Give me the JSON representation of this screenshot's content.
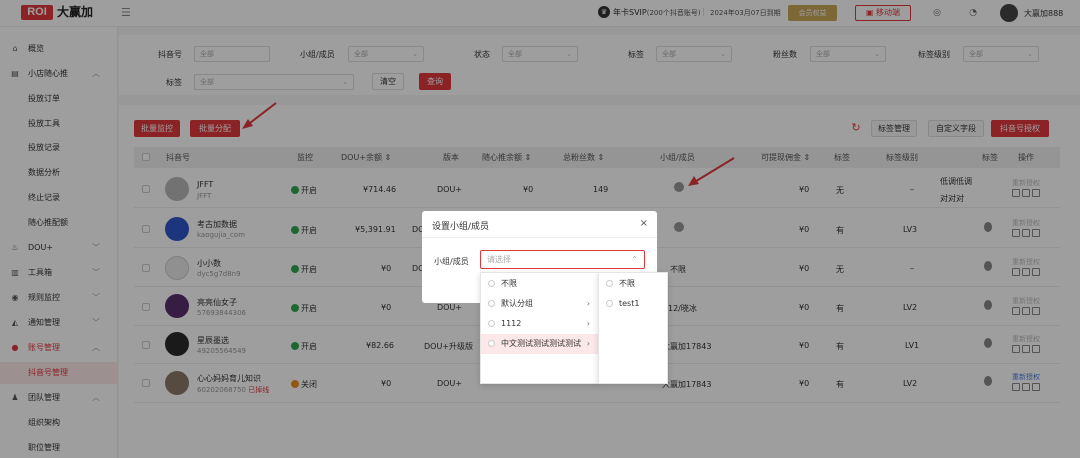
{
  "app": {
    "logo_mark": "ROI",
    "name": "大赢加",
    "menu_icon": "hamburger-icon"
  },
  "header": {
    "vip_label": "年卡SVIP",
    "vip_note": "(200个抖音账号)",
    "expire": "2024年03月07日到期",
    "member_button": "会员权益",
    "mobile_button": "移动端",
    "user_name": "大赢加888",
    "accent": "#e0393e",
    "gold": "#c9a65a"
  },
  "sidebar": {
    "items": [
      {
        "label": "概览",
        "icon": "home-icon"
      },
      {
        "label": "小店随心推",
        "icon": "store-icon",
        "chevron": "︿"
      },
      {
        "label": "投放订单"
      },
      {
        "label": "投放工具"
      },
      {
        "label": "投放记录"
      },
      {
        "label": "数据分析"
      },
      {
        "label": "终止记录"
      },
      {
        "label": "随心推配额"
      },
      {
        "label": "DOU+",
        "icon": "fire-icon",
        "chevron": "﹀"
      },
      {
        "label": "工具箱",
        "icon": "toolbox-icon",
        "chevron": "﹀"
      },
      {
        "label": "规则监控",
        "icon": "monitor-icon",
        "chevron": "﹀"
      },
      {
        "label": "通知管理",
        "icon": "bell-icon",
        "chevron": "﹀"
      },
      {
        "label": "账号管理",
        "icon": "user-icon",
        "chevron": "︿"
      },
      {
        "label": "抖音号管理"
      },
      {
        "label": "团队管理",
        "icon": "team-icon",
        "chevron": "︿"
      },
      {
        "label": "组织架构"
      },
      {
        "label": "职位管理"
      }
    ]
  },
  "filters": {
    "douyin_label": "抖音号",
    "douyin_value": "全部",
    "group_label": "小组/成员",
    "group_value": "全部",
    "status_label": "状态",
    "status_value": "全部",
    "tag_label1": "标签",
    "tag_value1": "全部",
    "fans_label": "粉丝数",
    "fans_value": "全部",
    "tag_level_label": "标签级别",
    "tag_level_value": "全部",
    "tag_label2": "标签",
    "tag_value2": "全部",
    "clear": "清空",
    "query": "查询"
  },
  "toolbar": {
    "batch_monitor": "批量监控",
    "batch_assign": "批量分配",
    "tag_manage": "标签管理",
    "custom_field": "自定义字段",
    "authorize": "抖音号授权"
  },
  "table": {
    "headers": {
      "account": "抖音号",
      "monitor": "监控",
      "dou_balance": "DOU+余额 ⇕",
      "version": "版本",
      "suixin_balance": "随心推余额 ⇕",
      "total_fans": "总粉丝数 ⇕",
      "group": "小组/成员",
      "withdraw": "可提现佣金 ⇕",
      "tag": "标签",
      "tag_level": "标签级别",
      "tag2": "标签",
      "action": "操作"
    },
    "rows": [
      {
        "name": "JFFT",
        "id": "JFFT",
        "monitor": "开启",
        "dou": "¥714.46",
        "version": "DOU+",
        "suixin": "¥0",
        "fans": "149",
        "group": "",
        "withdraw": "¥0",
        "tag": "无",
        "level": "–",
        "tag2a": "低调低调",
        "tag2b": "对对对",
        "action": "重新授权",
        "avatar_color": "#b8b8b8"
      },
      {
        "name": "考古加数据",
        "id": "kaogujia_com",
        "monitor": "开启",
        "dou": "¥5,391.91",
        "version": "DOU",
        "suixin": "",
        "fans": "",
        "group": "",
        "withdraw": "¥0",
        "tag": "有",
        "level": "LV3",
        "tag2a": "",
        "tag2b": "",
        "action": "重新授权",
        "avatar_color": "#2e56c8"
      },
      {
        "name": "小小数",
        "id": "dyc5g7d8n9",
        "monitor": "开启",
        "dou": "¥0",
        "version": "DOU",
        "suixin": "",
        "fans": "",
        "group": "不限",
        "withdraw": "¥0",
        "tag": "无",
        "level": "–",
        "tag2a": "",
        "tag2b": "",
        "action": "重新授权",
        "avatar_color": "#e8e8e8"
      },
      {
        "name": "亮亮仙女子",
        "id": "57693844306",
        "monitor": "开启",
        "dou": "¥0",
        "version": "DOU+",
        "suixin": "",
        "fans": "",
        "group": "12/晓冰",
        "withdraw": "¥0",
        "tag": "有",
        "level": "LV2",
        "tag2a": "",
        "tag2b": "",
        "action": "重新授权",
        "avatar_color": "#5a2e6e"
      },
      {
        "name": "星辰墨选",
        "id": "49205564549",
        "monitor": "开启",
        "dou": "¥82.66",
        "version": "DOU+升级版",
        "suixin": "",
        "fans": "",
        "group": "大赢加17843",
        "withdraw": "¥0",
        "tag": "有",
        "level": "LV1",
        "tag2a": "",
        "tag2b": "",
        "action": "重新授权",
        "avatar_color": "#2a2a2a"
      },
      {
        "name": "心心妈妈育儿知识",
        "id": "60202068750",
        "offline": "已掉线",
        "monitor": "关闭",
        "dou": "¥0",
        "version": "DOU+",
        "suixin": "",
        "fans": "",
        "group": "大赢加17843",
        "withdraw": "¥0",
        "tag": "有",
        "level": "LV2",
        "tag2a": "",
        "tag2b": "",
        "action": "重新授权",
        "avatar_color": "#8a7a6a"
      }
    ]
  },
  "modal": {
    "title": "设置小组/成员",
    "close": "×",
    "label": "小组/成员",
    "placeholder": "请选择",
    "options_level1": [
      {
        "label": "不限",
        "has_children": false
      },
      {
        "label": "默认分组",
        "has_children": true
      },
      {
        "label": "1112",
        "has_children": true
      },
      {
        "label": "中文测试测试测试测试",
        "has_children": true,
        "highlighted": true
      }
    ],
    "options_level2": [
      {
        "label": "不限"
      },
      {
        "label": "test1"
      }
    ]
  }
}
